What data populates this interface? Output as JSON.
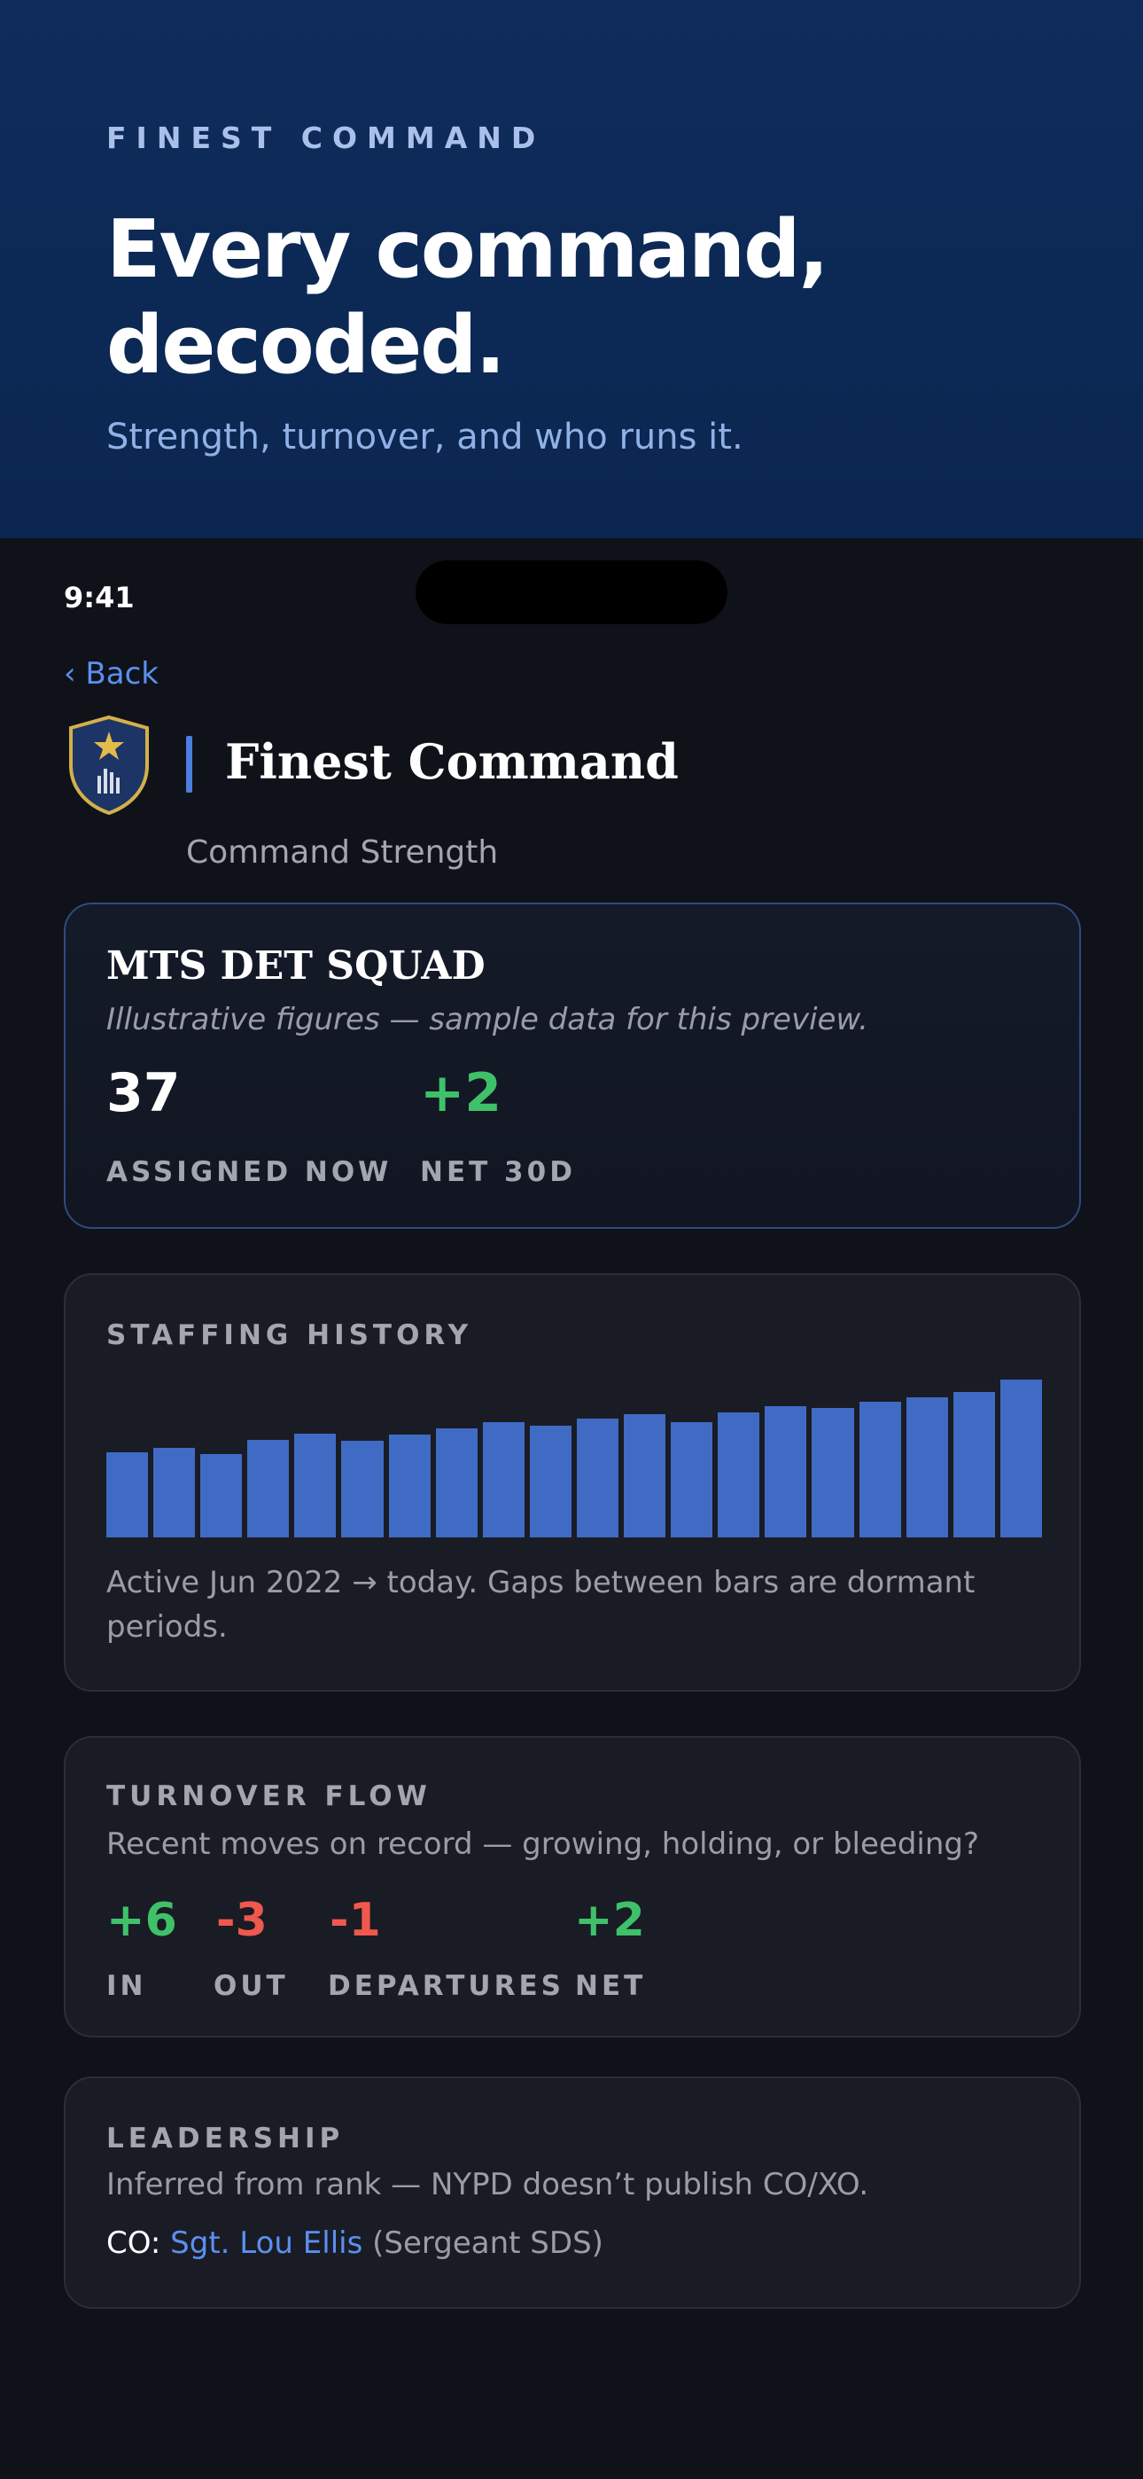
{
  "hero": {
    "eyebrow": "FINEST COMMAND",
    "title": "Every command, decoded.",
    "subtitle": "Strength, turnover, and who runs it."
  },
  "status_bar": {
    "time": "9:41"
  },
  "nav": {
    "back_label": "‹ Back"
  },
  "header": {
    "title": "Finest Command",
    "subtitle": "Command Strength"
  },
  "colors": {
    "accent": "#5c8ff0",
    "positive": "#3fc16a",
    "negative": "#f0584d",
    "bar": "#3f6bc4"
  },
  "squad_card": {
    "name": "MTS DET SQUAD",
    "note": "Illustrative figures — sample data for this preview.",
    "stats": [
      {
        "value": "37",
        "label": "ASSIGNED NOW"
      },
      {
        "value": "+2",
        "label": "NET 30D"
      }
    ]
  },
  "staffing_history": {
    "title": "STAFFING HISTORY",
    "caption": "Active Jun 2022 → today. Gaps between bars are dormant periods."
  },
  "chart_data": {
    "type": "bar",
    "values": [
      0.54,
      0.57,
      0.53,
      0.62,
      0.66,
      0.61,
      0.65,
      0.69,
      0.73,
      0.71,
      0.75,
      0.78,
      0.73,
      0.79,
      0.83,
      0.82,
      0.86,
      0.89,
      0.92,
      1.0
    ]
  },
  "turnover": {
    "title": "TURNOVER FLOW",
    "description": "Recent moves on record — growing, holding, or bleeding?",
    "stats": [
      {
        "value": "+6",
        "label": "IN"
      },
      {
        "value": "-3",
        "label": "OUT"
      },
      {
        "value": "-1",
        "label": "DEPARTURES"
      },
      {
        "value": "+2",
        "label": "NET"
      }
    ]
  },
  "leadership": {
    "title": "LEADERSHIP",
    "description": "Inferred from rank — NYPD doesn’t publish CO/XO.",
    "co_prefix": "CO:",
    "co_name": "Sgt. Lou Ellis",
    "co_rank": "(Sergeant SDS)"
  }
}
